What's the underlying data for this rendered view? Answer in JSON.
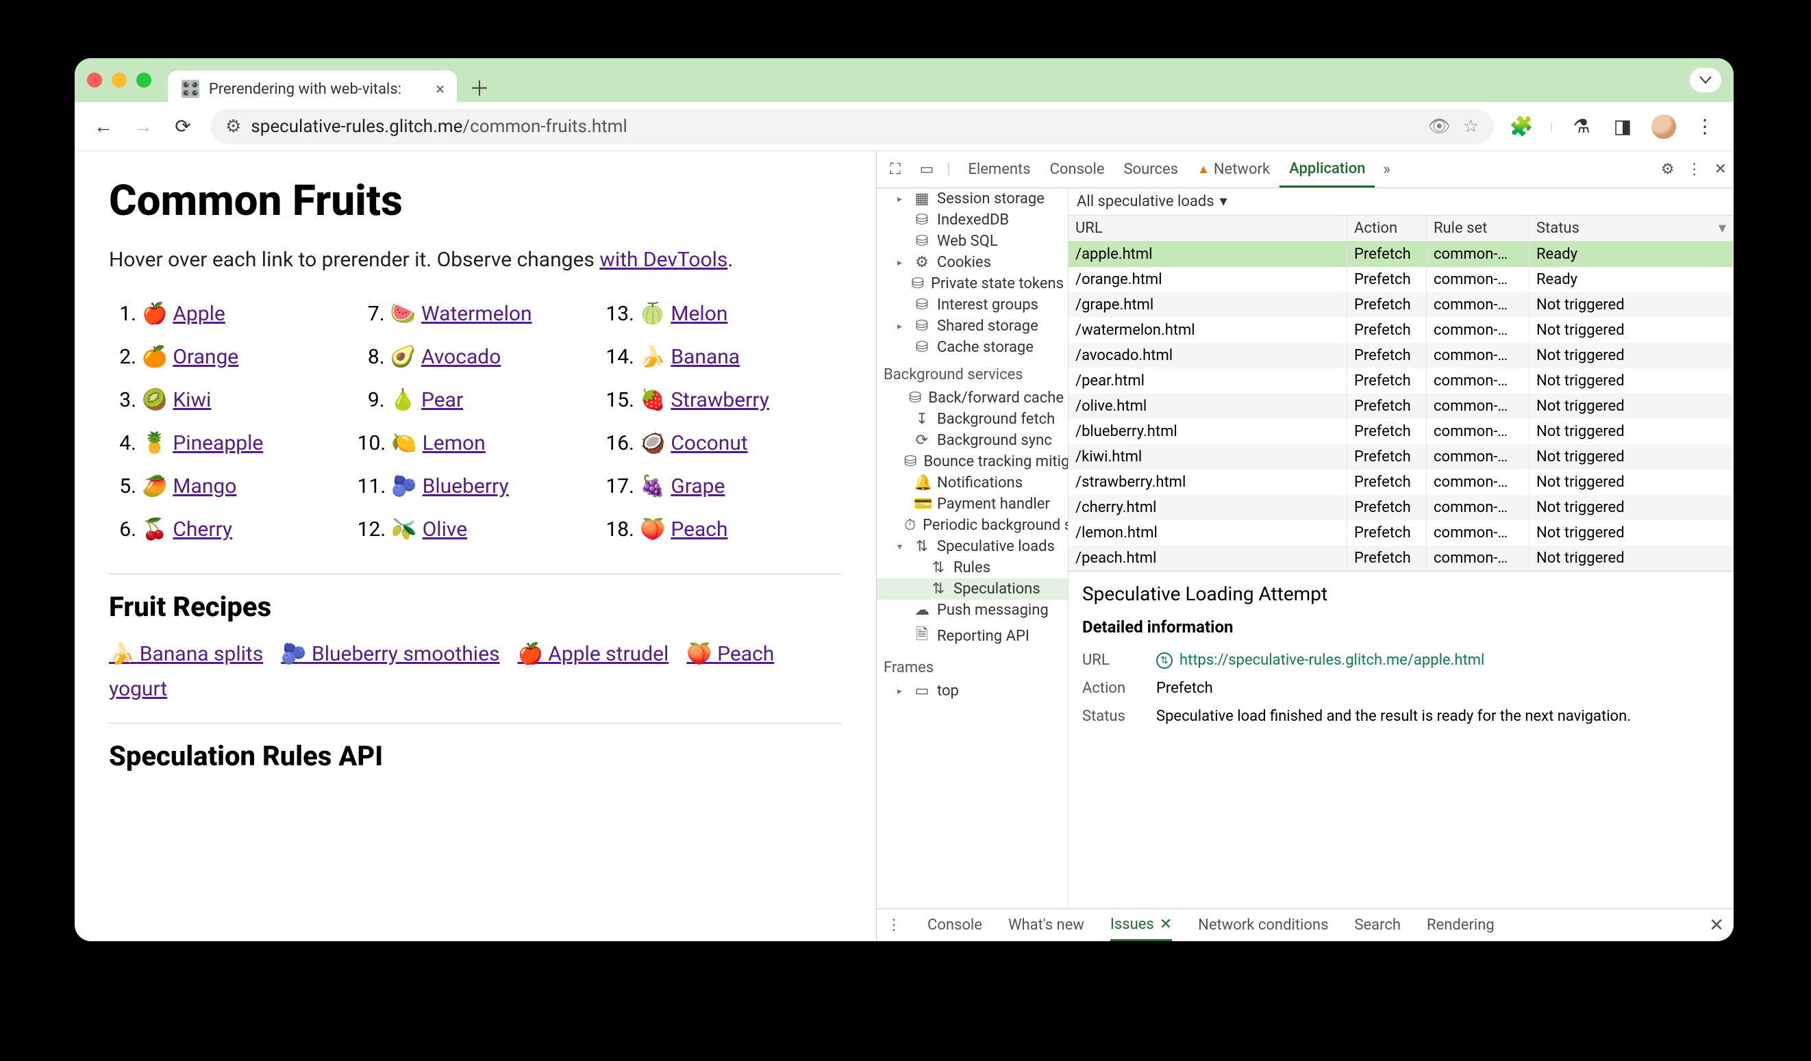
{
  "window": {
    "tab_title": "Prerendering with web-vitals:",
    "favicon": "🎛️"
  },
  "toolbar": {
    "url_host": "speculative-rules.glitch.me",
    "url_path": "/common-fruits.html"
  },
  "page": {
    "h1": "Common Fruits",
    "lead_before": "Hover over each link to prerender it. Observe changes ",
    "lead_link": "with DevTools",
    "lead_after": ".",
    "fruits": [
      {
        "n": "1.",
        "emoji": "🍎",
        "name": "Apple"
      },
      {
        "n": "2.",
        "emoji": "🍊",
        "name": "Orange"
      },
      {
        "n": "3.",
        "emoji": "🥝",
        "name": "Kiwi"
      },
      {
        "n": "4.",
        "emoji": "🍍",
        "name": "Pineapple"
      },
      {
        "n": "5.",
        "emoji": "🥭",
        "name": "Mango"
      },
      {
        "n": "6.",
        "emoji": "🍒",
        "name": "Cherry"
      },
      {
        "n": "7.",
        "emoji": "🍉",
        "name": "Watermelon"
      },
      {
        "n": "8.",
        "emoji": "🥑",
        "name": "Avocado"
      },
      {
        "n": "9.",
        "emoji": "🍐",
        "name": "Pear"
      },
      {
        "n": "10.",
        "emoji": "🍋",
        "name": "Lemon"
      },
      {
        "n": "11.",
        "emoji": "🫐",
        "name": "Blueberry"
      },
      {
        "n": "12.",
        "emoji": "🫒",
        "name": "Olive"
      },
      {
        "n": "13.",
        "emoji": "🍈",
        "name": "Melon"
      },
      {
        "n": "14.",
        "emoji": "🍌",
        "name": "Banana"
      },
      {
        "n": "15.",
        "emoji": "🍓",
        "name": "Strawberry"
      },
      {
        "n": "16.",
        "emoji": "🥥",
        "name": "Coconut"
      },
      {
        "n": "17.",
        "emoji": "🍇",
        "name": "Grape"
      },
      {
        "n": "18.",
        "emoji": "🍑",
        "name": "Peach"
      }
    ],
    "h2_recipes": "Fruit Recipes",
    "recipes": [
      {
        "emoji": "🍌",
        "name": "Banana splits"
      },
      {
        "emoji": "🫐",
        "name": "Blueberry smoothies"
      },
      {
        "emoji": "🍎",
        "name": "Apple strudel"
      },
      {
        "emoji": "🍑",
        "name": "Peach yogurt"
      }
    ],
    "h2_api": "Speculation Rules API"
  },
  "devtools": {
    "tabs": [
      "Elements",
      "Console",
      "Sources",
      "Network",
      "Application"
    ],
    "active_tab": "Application",
    "sidebar_storage": [
      {
        "arrow": "▸",
        "icon": "▦",
        "label": "Session storage"
      },
      {
        "arrow": "",
        "icon": "⛁",
        "label": "IndexedDB"
      },
      {
        "arrow": "",
        "icon": "⛁",
        "label": "Web SQL"
      },
      {
        "arrow": "▸",
        "icon": "⚙",
        "label": "Cookies"
      },
      {
        "arrow": "",
        "icon": "⛁",
        "label": "Private state tokens"
      },
      {
        "arrow": "",
        "icon": "⛁",
        "label": "Interest groups"
      },
      {
        "arrow": "▸",
        "icon": "⛁",
        "label": "Shared storage"
      },
      {
        "arrow": "",
        "icon": "⛁",
        "label": "Cache storage"
      }
    ],
    "bg_heading": "Background services",
    "sidebar_bg": [
      {
        "icon": "⛁",
        "label": "Back/forward cache"
      },
      {
        "icon": "↧",
        "label": "Background fetch"
      },
      {
        "icon": "⟳",
        "label": "Background sync"
      },
      {
        "icon": "⛁",
        "label": "Bounce tracking mitigations"
      },
      {
        "icon": "🔔",
        "label": "Notifications"
      },
      {
        "icon": "💳",
        "label": "Payment handler"
      },
      {
        "icon": "⏱",
        "label": "Periodic background sync"
      }
    ],
    "speculative": {
      "arrow": "▾",
      "icon": "⇅",
      "label": "Speculative loads",
      "children": [
        {
          "icon": "⇅",
          "label": "Rules"
        },
        {
          "icon": "⇅",
          "label": "Speculations",
          "selected": true
        }
      ]
    },
    "sidebar_bg_tail": [
      {
        "icon": "☁",
        "label": "Push messaging"
      },
      {
        "icon": "🗎",
        "label": "Reporting API"
      }
    ],
    "frames_heading": "Frames",
    "frames": [
      {
        "arrow": "▸",
        "icon": "▭",
        "label": "top"
      }
    ],
    "filter_label": "All speculative loads",
    "columns": {
      "url": "URL",
      "action": "Action",
      "rule": "Rule set",
      "status": "Status"
    },
    "rows": [
      {
        "url": "/apple.html",
        "action": "Prefetch",
        "rule": "common-…",
        "status": "Ready",
        "selected": true
      },
      {
        "url": "/orange.html",
        "action": "Prefetch",
        "rule": "common-…",
        "status": "Ready"
      },
      {
        "url": "/grape.html",
        "action": "Prefetch",
        "rule": "common-…",
        "status": "Not triggered"
      },
      {
        "url": "/watermelon.html",
        "action": "Prefetch",
        "rule": "common-…",
        "status": "Not triggered"
      },
      {
        "url": "/avocado.html",
        "action": "Prefetch",
        "rule": "common-…",
        "status": "Not triggered"
      },
      {
        "url": "/pear.html",
        "action": "Prefetch",
        "rule": "common-…",
        "status": "Not triggered"
      },
      {
        "url": "/olive.html",
        "action": "Prefetch",
        "rule": "common-…",
        "status": "Not triggered"
      },
      {
        "url": "/blueberry.html",
        "action": "Prefetch",
        "rule": "common-…",
        "status": "Not triggered"
      },
      {
        "url": "/kiwi.html",
        "action": "Prefetch",
        "rule": "common-…",
        "status": "Not triggered"
      },
      {
        "url": "/strawberry.html",
        "action": "Prefetch",
        "rule": "common-…",
        "status": "Not triggered"
      },
      {
        "url": "/cherry.html",
        "action": "Prefetch",
        "rule": "common-…",
        "status": "Not triggered"
      },
      {
        "url": "/lemon.html",
        "action": "Prefetch",
        "rule": "common-…",
        "status": "Not triggered"
      },
      {
        "url": "/peach.html",
        "action": "Prefetch",
        "rule": "common-…",
        "status": "Not triggered"
      }
    ],
    "detail": {
      "title": "Speculative Loading Attempt",
      "section": "Detailed information",
      "url_label": "URL",
      "url_value": "https://speculative-rules.glitch.me/apple.html",
      "action_label": "Action",
      "action_value": "Prefetch",
      "status_label": "Status",
      "status_value": "Speculative load finished and the result is ready for the next navigation."
    },
    "drawer": [
      "Console",
      "What's new",
      "Issues",
      "Network conditions",
      "Search",
      "Rendering"
    ],
    "drawer_active": "Issues"
  }
}
